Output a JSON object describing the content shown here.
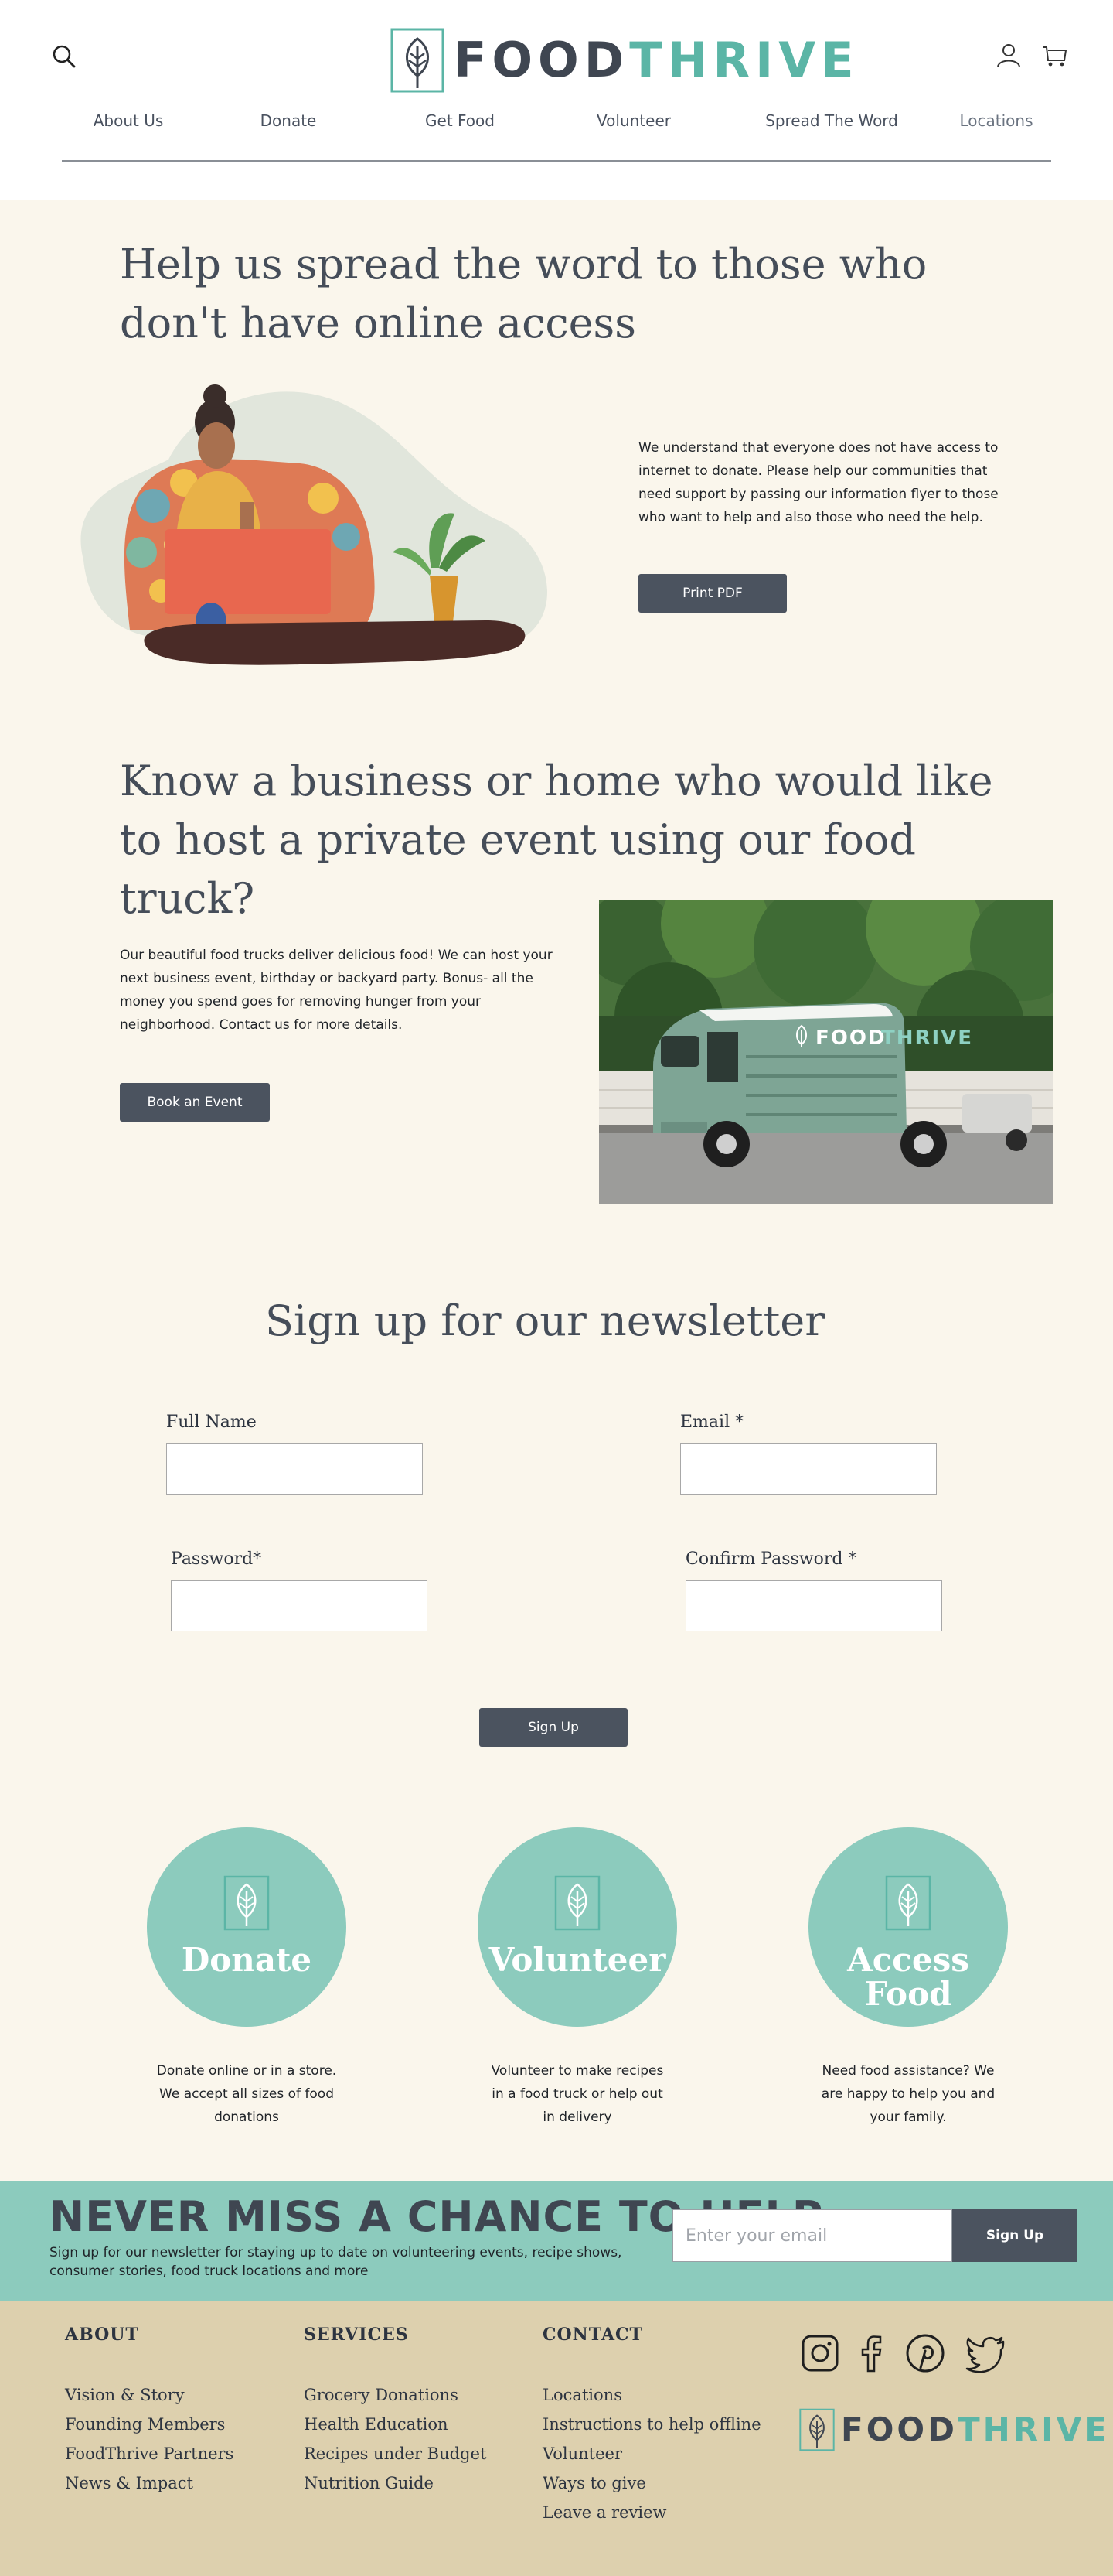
{
  "header": {
    "logo": {
      "word_a": "FOOD",
      "word_b": "THRIVE"
    },
    "nav": [
      "About Us",
      "Donate",
      "Get Food",
      "Volunteer",
      "Spread The Word",
      "Locations"
    ]
  },
  "spread": {
    "title": "Help us spread the word to those who don't have online access",
    "text": "We understand that everyone does not have access to internet to donate. Please help our communities that need support by passing our information flyer to those who want to help and also those who need the help.",
    "button": "Print PDF"
  },
  "host": {
    "title": "Know a business or home who would like to host a private event using our food truck?",
    "text": "Our beautiful food trucks deliver delicious food! We can host your next business event, birthday or backyard party. Bonus- all the money you spend goes for removing hunger from your neighborhood. Contact us for more details.",
    "button": "Book an Event",
    "truck_sign": {
      "word_a": "FOOD",
      "word_b": "THRIVE"
    }
  },
  "newsletter": {
    "title": "Sign up for our newsletter",
    "full_name_label": "Full Name",
    "email_label": "Email *",
    "password_label": "Password*",
    "confirm_label": "Confirm Password *",
    "button": "Sign Up"
  },
  "actions": [
    {
      "label": "Donate",
      "desc": "Donate online or in a store. We accept all sizes of food donations"
    },
    {
      "label": "Volunteer",
      "desc": "Volunteer to make recipes in a food truck or help out in delivery"
    },
    {
      "label": "Access Food",
      "desc": "Need food assistance? We are happy to help you and your family."
    }
  ],
  "banner": {
    "title": "NEVER MISS A CHANCE TO HELP",
    "subtitle": "Sign up for our newsletter for staying up to date on volunteering events, recipe shows, consumer stories, food truck locations and more",
    "email_placeholder": "Enter your email",
    "button": "Sign Up"
  },
  "footer": {
    "about": {
      "heading": "ABOUT",
      "links": [
        "Vision & Story",
        "Founding Members",
        "FoodThrive Partners",
        "News & Impact"
      ]
    },
    "services": {
      "heading": "SERVICES",
      "links": [
        "Grocery Donations",
        "Health Education",
        "Recipes under Budget",
        "Nutrition Guide"
      ]
    },
    "contact": {
      "heading": "CONTACT",
      "links": [
        "Locations",
        "Instructions to help offline",
        "Volunteer",
        "Ways to give",
        "Leave a review"
      ]
    },
    "social_icons": [
      "instagram-icon",
      "facebook-icon",
      "pinterest-icon",
      "twitter-icon"
    ],
    "logo": {
      "word_a": "FOOD",
      "word_b": "THRIVE"
    }
  },
  "colors": {
    "teal": "#8ccbbd",
    "teal_dark": "#5bb5a6",
    "slate": "#454d59",
    "button": "#4b535f",
    "cream": "#faf6ec",
    "sand": "#ddd0ae"
  }
}
